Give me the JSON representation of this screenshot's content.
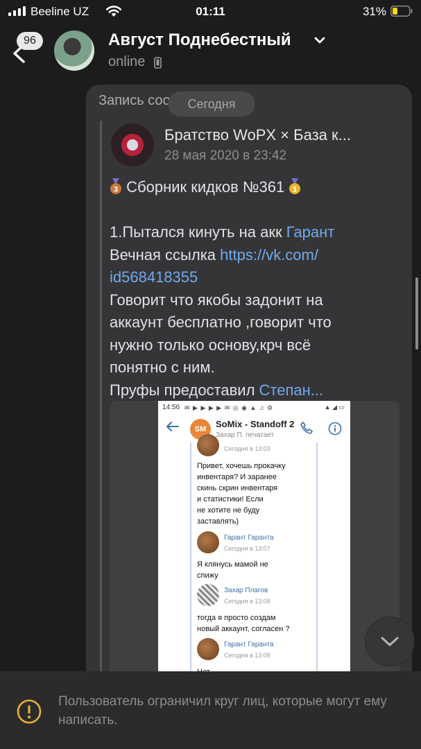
{
  "status_bar": {
    "carrier": "Beeline UZ",
    "time": "01:11",
    "battery_percent": "31%",
    "battery_level": 0.31,
    "battery_color": "#ffd60a"
  },
  "header": {
    "unread_badge": "96",
    "contact_name": "Август Поднебестный",
    "contact_status": "online"
  },
  "chat": {
    "date_pill": "Сегодня",
    "bubble_header": "Запись сообщества",
    "post": {
      "group_name": "Братство WoPX × База к...",
      "date": "28 мая 2020 в 23:42",
      "title": "Сборник кидков №361",
      "lines": [
        {
          "text": "1.Пытался кинуть на акк ",
          "link": "Гарант"
        },
        {
          "text": "Вечная ссылка ",
          "link": "https://vk.com/"
        },
        {
          "text": "",
          "link": "id568418355"
        },
        {
          "text": "Говорит что якобы задонит на",
          "link": ""
        },
        {
          "text": "аккаунт бесплатно ,говорит что",
          "link": ""
        },
        {
          "text": "нужно только основу,крч всё",
          "link": ""
        },
        {
          "text": "понятно с ним.",
          "link": ""
        },
        {
          "text": "Пруфы предоставил ",
          "link": "Степан..."
        }
      ]
    },
    "attachment": {
      "status_time": "14:56",
      "chat_title": "SoMix - Standoff 2",
      "chat_avatar_text": "SM",
      "typing_status": "Захар П. печатает",
      "messages": [
        {
          "avatar": "g",
          "sender": "",
          "time": "Сегодня в 13:03",
          "text": "Привет, хочешь прокачку\nинвентаря? И заранее\nскинь скрин инвентаря\nи статистики! Если\nне хотите не буду\nзаставлять)"
        },
        {
          "avatar": "g",
          "sender": "Гарант Гаранта",
          "time": "Сегодня в 13:07",
          "text": "Я клянусь мамой не\nспижу"
        },
        {
          "avatar": "z",
          "sender": "Захар Плагов",
          "time": "Сегодня в 13:08",
          "text": "тогда я просто создам\nновый аккаунт, согласен ?"
        },
        {
          "avatar": "g",
          "sender": "Гарант Гаранта",
          "time": "Сегодня в 13:08",
          "text": "Нет"
        }
      ]
    }
  },
  "notice": {
    "text": "Пользователь ограничил круг лиц, которые могут ему написать."
  },
  "colors": {
    "background": "#1c1c1c",
    "bubble": "#353537",
    "link": "#71aaeb",
    "warning": "#e8b13a"
  }
}
